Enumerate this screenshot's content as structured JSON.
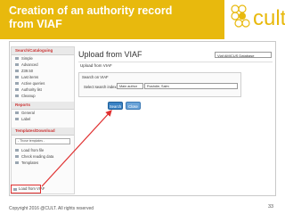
{
  "slide": {
    "title": "Creation of an authority record from VIAF",
    "logo_text": "cult",
    "footer": "Copyright 2016 @CULT. All rights reserved",
    "page_number": "33"
  },
  "sidebar": {
    "sections": [
      {
        "heading": "Search/Cataloguing",
        "items": [
          "Simple",
          "Advanced",
          "Z39.50",
          "Last items",
          "Active queries",
          "Authority list",
          "Cleanup"
        ]
      },
      {
        "heading": "Reports",
        "items": [
          "General",
          "Label"
        ]
      },
      {
        "heading": "Templates/Download",
        "template_select": "- Those templates -",
        "items": [
          "Load from file",
          "Check reading data",
          "Templates"
        ]
      }
    ],
    "highlighted_item": "Load from VIAF"
  },
  "main": {
    "title": "Upload from VIAF",
    "database_select": "Viaf AMICUS Database",
    "subtitle": "Upload from VIAF",
    "search_box_title": "Search on VIAF",
    "field_label": "Select search index:",
    "index_value": "Main author",
    "search_term": "Rushdie, Salm",
    "buttons": {
      "search": "Search",
      "close": "Close"
    }
  },
  "colors": {
    "header_bg": "#e8b90d",
    "highlight": "#e03030",
    "button": "#3a82c4"
  }
}
